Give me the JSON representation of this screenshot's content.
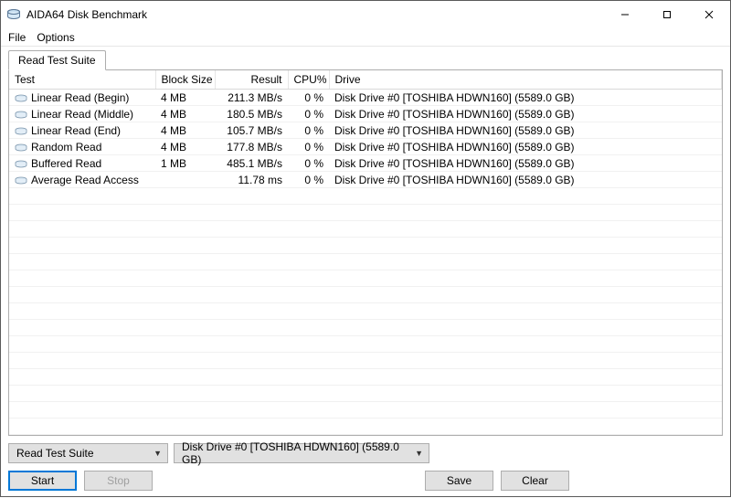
{
  "window": {
    "title": "AIDA64 Disk Benchmark"
  },
  "menu": {
    "file": "File",
    "options": "Options"
  },
  "tabs": {
    "read_suite": "Read Test Suite"
  },
  "columns": {
    "test": "Test",
    "block": "Block Size",
    "result": "Result",
    "cpu": "CPU%",
    "drive": "Drive"
  },
  "drive_full": "Disk Drive #0  [TOSHIBA HDWN160]  (5589.0 GB)",
  "rows": [
    {
      "test": "Linear Read (Begin)",
      "block": "4 MB",
      "result": "211.3 MB/s",
      "cpu": "0 %"
    },
    {
      "test": "Linear Read (Middle)",
      "block": "4 MB",
      "result": "180.5 MB/s",
      "cpu": "0 %"
    },
    {
      "test": "Linear Read (End)",
      "block": "4 MB",
      "result": "105.7 MB/s",
      "cpu": "0 %"
    },
    {
      "test": "Random Read",
      "block": "4 MB",
      "result": "177.8 MB/s",
      "cpu": "0 %"
    },
    {
      "test": "Buffered Read",
      "block": "1 MB",
      "result": "485.1 MB/s",
      "cpu": "0 %"
    },
    {
      "test": "Average Read Access",
      "block": "",
      "result": "11.78 ms",
      "cpu": "0 %"
    }
  ],
  "combos": {
    "suite": "Read Test Suite",
    "drive": "Disk Drive #0  [TOSHIBA HDWN160]  (5589.0 GB)"
  },
  "buttons": {
    "start": "Start",
    "stop": "Stop",
    "save": "Save",
    "clear": "Clear"
  }
}
